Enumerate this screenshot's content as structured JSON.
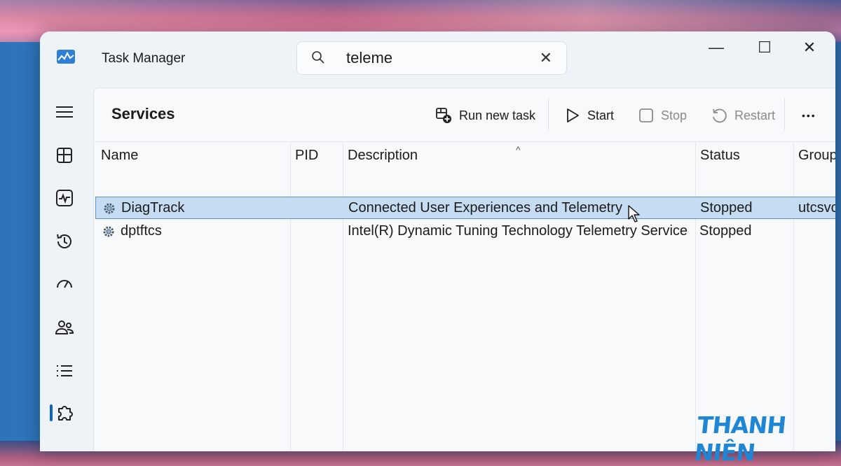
{
  "window": {
    "title": "Task Manager"
  },
  "search": {
    "value": "teleme"
  },
  "window_controls": {
    "minimize": "—",
    "maximize": "☐",
    "close": "✕"
  },
  "sidebar": {
    "items": [
      {
        "name": "menu",
        "icon": "hamburger-icon"
      },
      {
        "name": "processes",
        "icon": "processes-icon"
      },
      {
        "name": "performance",
        "icon": "performance-icon"
      },
      {
        "name": "app-history",
        "icon": "history-icon"
      },
      {
        "name": "startup-apps",
        "icon": "speedometer-icon"
      },
      {
        "name": "users",
        "icon": "users-icon"
      },
      {
        "name": "details",
        "icon": "list-icon"
      },
      {
        "name": "services",
        "icon": "puzzle-icon",
        "active": true
      }
    ]
  },
  "panel": {
    "title": "Services",
    "toolbar": {
      "run_new_task": "Run new task",
      "start": "Start",
      "stop": "Stop",
      "restart": "Restart",
      "more": "•••"
    },
    "columns": [
      "Name",
      "PID",
      "Description",
      "Status",
      "Group"
    ],
    "rows": [
      {
        "name": "DiagTrack",
        "pid": "",
        "description": "Connected User Experiences and Telemetry",
        "status": "Stopped",
        "group": "utcsvc",
        "selected": true
      },
      {
        "name": "dptftcs",
        "pid": "",
        "description": "Intel(R) Dynamic Tuning Technology Telemetry Service",
        "status": "Stopped",
        "group": ""
      }
    ]
  },
  "watermark": "THANH NIÊN",
  "colors": {
    "accent": "#0a64c8",
    "selection": "#c5dcf3",
    "watermark": "#1f86d6"
  }
}
